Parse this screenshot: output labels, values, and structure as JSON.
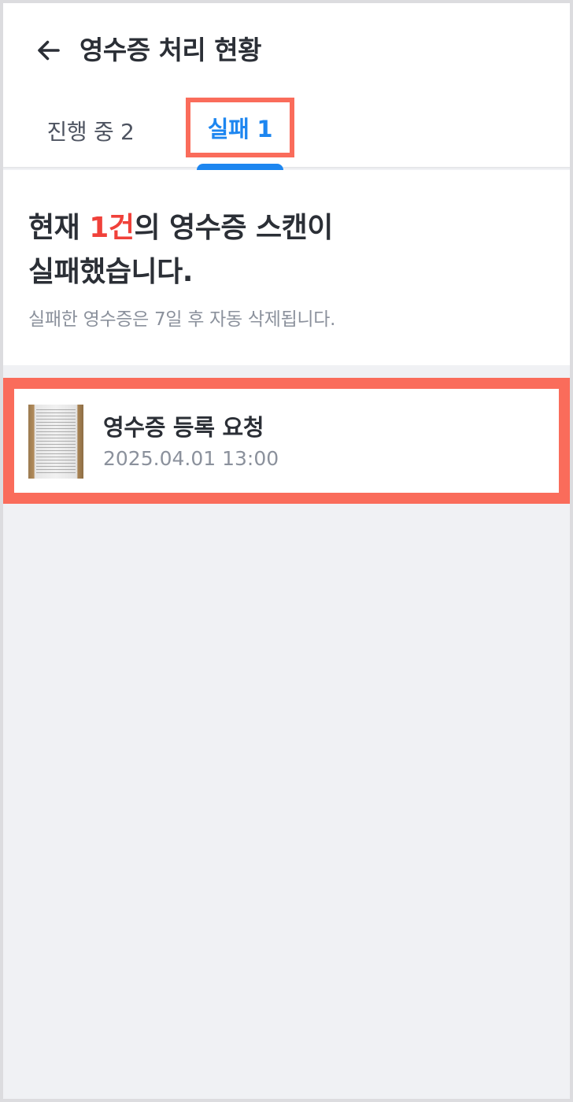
{
  "header": {
    "title": "영수증 처리 현황",
    "back_icon": "arrow-left-icon"
  },
  "tabs": [
    {
      "label": "진행 중 2",
      "selected": false
    },
    {
      "label": "실패 1",
      "selected": true
    }
  ],
  "summary": {
    "heading_prefix": "현재 ",
    "heading_count": "1건",
    "heading_suffix_line1": "의 영수증 스캔이",
    "heading_line2": "실패했습니다.",
    "subtext": "실패한 영수증은 7일 후 자동 삭제됩니다."
  },
  "failed_items": [
    {
      "title": "영수증 등록 요청",
      "date": "2025.04.01 13:00",
      "thumbnail": "receipt-thumbnail"
    }
  ],
  "colors": {
    "accent": "#1d86f0",
    "error": "#f0413a",
    "highlight": "#fa6c5b",
    "background": "#f0f1f4"
  }
}
